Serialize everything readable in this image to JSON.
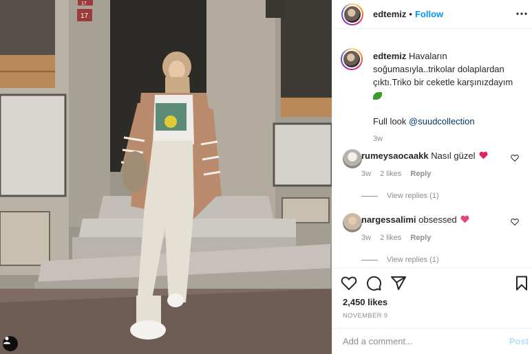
{
  "photo": {
    "alt_icon": "user-tag-icon",
    "door_numbers": [
      "17",
      "17"
    ]
  },
  "header": {
    "username": "edtemiz",
    "separator": "•",
    "follow_label": "Follow",
    "more_icon": "more-options-icon"
  },
  "caption": {
    "username": "edtemiz",
    "text": "Havaların soğumasıyla..trikolar dolaplardan çıktı.Triko bir ceketle karşınızdayım",
    "emoji": "leaf-emoji",
    "full_look_label": "Full look",
    "mention": "@suudcollection",
    "time": "3w"
  },
  "comments": [
    {
      "username": "rumeysaocaakk",
      "text": "Nasıl güzel",
      "emoji": "red-heart",
      "time": "3w",
      "likes": "2 likes",
      "reply_label": "Reply",
      "view_replies": "View replies (1)"
    },
    {
      "username": "nargessalimi",
      "text": "obsessed",
      "emoji": "pink-heart",
      "time": "3w",
      "likes": "2 likes",
      "reply_label": "Reply",
      "view_replies": "View replies (1)"
    }
  ],
  "actions": {
    "likes": "2,450 likes",
    "date": "NOVEMBER 9",
    "comment_placeholder": "Add a comment...",
    "post_label": "Post"
  },
  "colors": {
    "accent": "#0095f6",
    "post_disabled": "#b2dffc",
    "muted": "#8e8e8e",
    "heart": "#ed4956"
  }
}
